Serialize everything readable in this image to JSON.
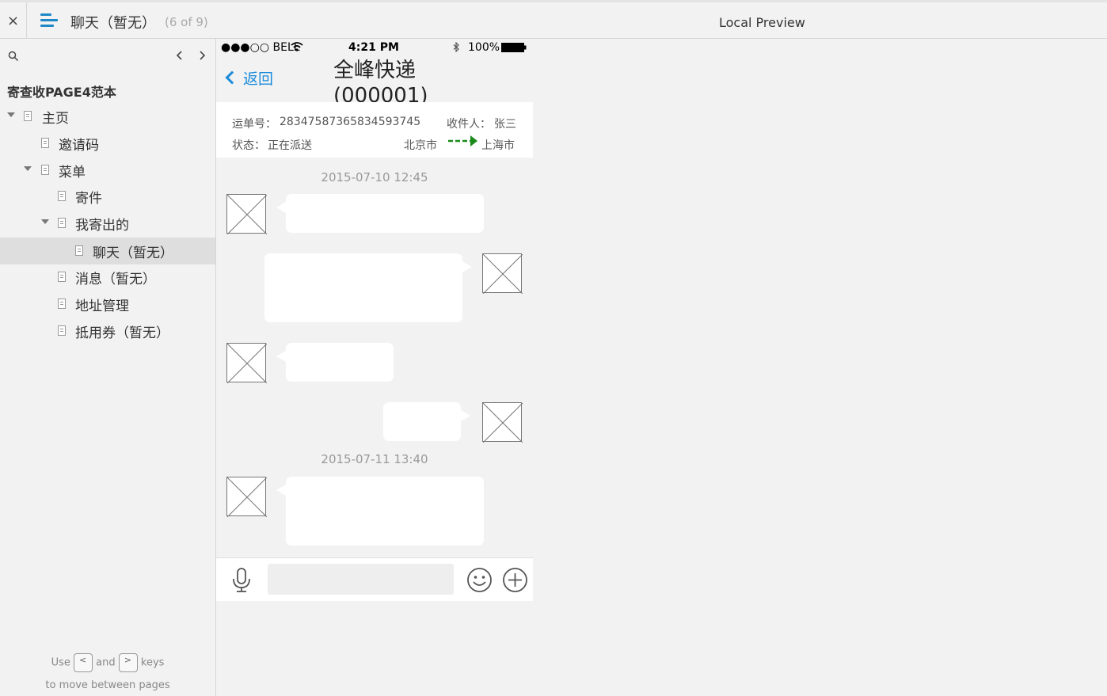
{
  "topbar": {
    "close_label": "×",
    "page_title": "聊天（暂无）",
    "page_count": "(6 of 9)",
    "preview_label": "Local Preview"
  },
  "sidebar": {
    "prev_label": "‹",
    "next_label": "›",
    "project_title": "寄查收PAGE4范本",
    "tree": [
      {
        "label": "主页",
        "expanded": true
      },
      {
        "label": "邀请码"
      },
      {
        "label": "菜单",
        "expanded": true
      },
      {
        "label": "寄件"
      },
      {
        "label": "我寄出的",
        "expanded": true
      },
      {
        "label": "聊天（暂无）",
        "active": true
      },
      {
        "label": "消息（暂无）"
      },
      {
        "label": "地址管理"
      },
      {
        "label": "抵用券（暂无）"
      }
    ],
    "hint": {
      "use": "Use",
      "key_prev": "<",
      "and": "and",
      "key_next": ">",
      "keys": "keys",
      "line2": "to move between pages"
    }
  },
  "phone": {
    "status": {
      "carrier": "●●●○○ BELL",
      "time": "4:21 PM",
      "battery": "100%"
    },
    "nav": {
      "back_label": "返回",
      "title": "全峰快递(000001)"
    },
    "info": {
      "tracking_label": "运单号：",
      "tracking_number": "28347587365834593745",
      "recipient_label": "收件人：",
      "recipient_name": "张三",
      "status_label": "状态：",
      "status_value": "正在派送",
      "from_city": "北京市",
      "arrow": "--->",
      "to_city": "上海市"
    },
    "timestamps": [
      "2015-07-10  12:45",
      "2015-07-11  13:40"
    ]
  },
  "colors": {
    "accent": "#1a8bdb",
    "route_arrow": "#1a8a1a",
    "hamburger": "#1e88c8"
  }
}
